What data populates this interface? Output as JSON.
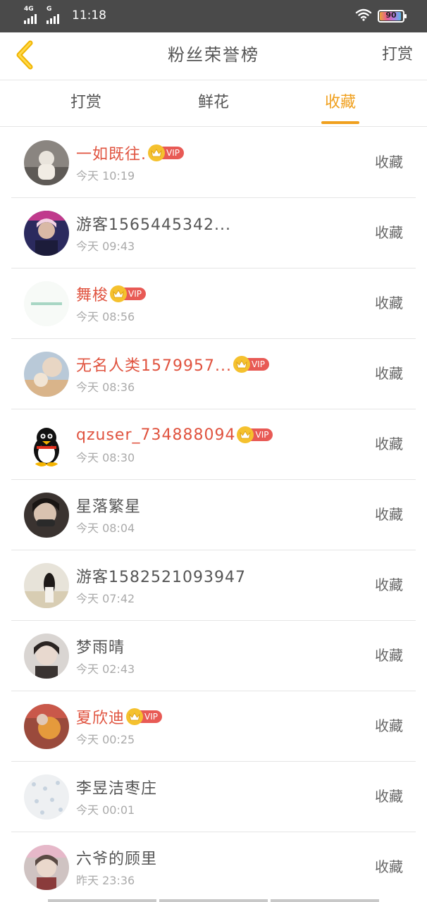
{
  "status_bar": {
    "net1": "4G",
    "net2": "G",
    "time": "11:18",
    "battery": "90"
  },
  "header": {
    "title": "粉丝荣誉榜",
    "right_label": "打赏"
  },
  "tabs": [
    {
      "label": "打赏"
    },
    {
      "label": "鲜花"
    },
    {
      "label": "收藏"
    }
  ],
  "active_tab": "收藏",
  "colors": {
    "accent": "#f0a01e",
    "vip_name": "#e0533f",
    "vip_badge": "#e85a55",
    "crown": "#f5c12e"
  },
  "vip_label": "VIP",
  "fans": [
    {
      "name": "一如既往.",
      "time": "今天 10:19",
      "action": "收藏",
      "vip": true
    },
    {
      "name": "游客1565445342...",
      "time": "今天 09:43",
      "action": "收藏",
      "vip": false
    },
    {
      "name": "舞梭",
      "time": "今天 08:56",
      "action": "收藏",
      "vip": true
    },
    {
      "name": "无名人类1579957...",
      "time": "今天 08:36",
      "action": "收藏",
      "vip": true
    },
    {
      "name": "qzuser_734888094",
      "time": "今天 08:30",
      "action": "收藏",
      "vip": true
    },
    {
      "name": "星落繁星",
      "time": "今天 08:04",
      "action": "收藏",
      "vip": false
    },
    {
      "name": "游客1582521093947",
      "time": "今天 07:42",
      "action": "收藏",
      "vip": false
    },
    {
      "name": "梦雨晴",
      "time": "今天 02:43",
      "action": "收藏",
      "vip": false
    },
    {
      "name": "夏欣迪",
      "time": "今天 00:25",
      "action": "收藏",
      "vip": true
    },
    {
      "name": "李昱洁枣庄",
      "time": "今天 00:01",
      "action": "收藏",
      "vip": false
    },
    {
      "name": "六爷的顾里",
      "time": "昨天 23:36",
      "action": "收藏",
      "vip": false
    }
  ]
}
